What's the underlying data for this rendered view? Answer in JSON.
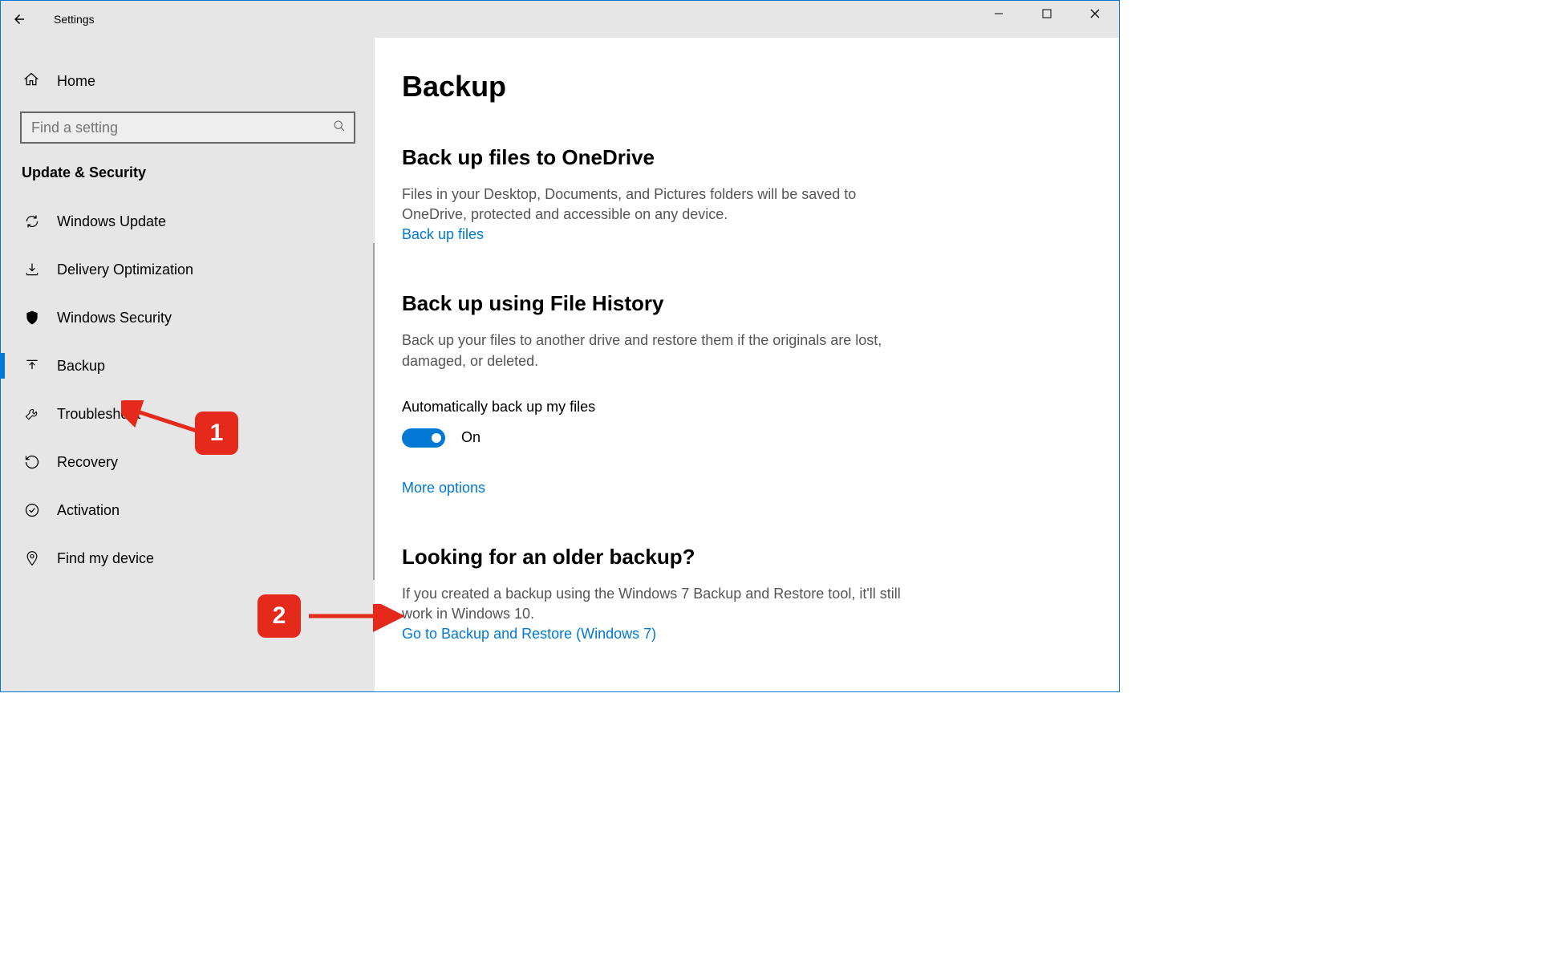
{
  "window": {
    "title": "Settings"
  },
  "sidebar": {
    "home_label": "Home",
    "search_placeholder": "Find a setting",
    "section_title": "Update & Security",
    "items": [
      {
        "label": "Windows Update"
      },
      {
        "label": "Delivery Optimization"
      },
      {
        "label": "Windows Security"
      },
      {
        "label": "Backup"
      },
      {
        "label": "Troubleshoot"
      },
      {
        "label": "Recovery"
      },
      {
        "label": "Activation"
      },
      {
        "label": "Find my device"
      }
    ]
  },
  "main": {
    "title": "Backup",
    "section1": {
      "heading": "Back up files to OneDrive",
      "desc": "Files in your Desktop, Documents, and Pictures folders will be saved to OneDrive, protected and accessible on any device.",
      "link": "Back up files"
    },
    "section2": {
      "heading": "Back up using File History",
      "desc": "Back up your files to another drive and restore them if the originals are lost, damaged, or deleted.",
      "toggle_label": "Automatically back up my files",
      "toggle_state": "On",
      "link": "More options"
    },
    "section3": {
      "heading": "Looking for an older backup?",
      "desc": "If you created a backup using the Windows 7 Backup and Restore tool, it'll still work in Windows 10.",
      "link": "Go to Backup and Restore (Windows 7)"
    }
  },
  "annotations": {
    "badge1": "1",
    "badge2": "2"
  }
}
